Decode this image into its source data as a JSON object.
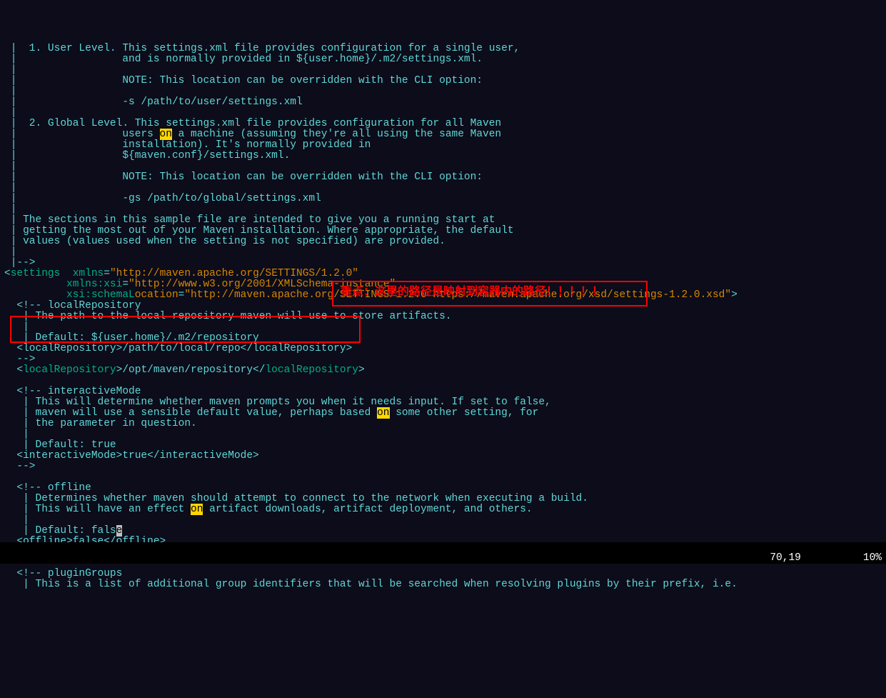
{
  "lines": [
    {
      "t": " |  1. User Level. This settings.xml file provides configuration for a single user,",
      "c": "cyan"
    },
    {
      "t": " |                 and is normally provided in ${user.home}/.m2/settings.xml.",
      "c": "cyan"
    },
    {
      "t": " |",
      "c": "cyan"
    },
    {
      "t": " |                 NOTE: This location can be overridden with the CLI option:",
      "c": "cyan"
    },
    {
      "t": " |",
      "c": "cyan"
    },
    {
      "t": " |                 -s /path/to/user/settings.xml",
      "c": "cyan"
    },
    {
      "t": " |",
      "c": "cyan"
    },
    {
      "t": " |  2. Global Level. This settings.xml file provides configuration for all Maven",
      "c": "cyan"
    },
    {
      "segs": [
        {
          "t": " |                 users ",
          "c": "cyan"
        },
        {
          "t": "on",
          "c": "hl"
        },
        {
          "t": " a machine (assuming they're all using the same Maven",
          "c": "cyan"
        }
      ]
    },
    {
      "t": " |                 installation). It's normally provided in",
      "c": "cyan"
    },
    {
      "t": " |                 ${maven.conf}/settings.xml.",
      "c": "cyan"
    },
    {
      "t": " |",
      "c": "cyan"
    },
    {
      "t": " |                 NOTE: This location can be overridden with the CLI option:",
      "c": "cyan"
    },
    {
      "t": " |",
      "c": "cyan"
    },
    {
      "t": " |                 -gs /path/to/global/settings.xml",
      "c": "cyan"
    },
    {
      "t": " |",
      "c": "cyan"
    },
    {
      "t": " | The sections in this sample file are intended to give you a running start at",
      "c": "cyan"
    },
    {
      "t": " | getting the most out of your Maven installation. Where appropriate, the default",
      "c": "cyan"
    },
    {
      "t": " | values (values used when the setting is not specified) are provided.",
      "c": "cyan"
    },
    {
      "t": " |",
      "c": "cyan"
    },
    {
      "t": " |-->",
      "c": "cyan"
    },
    {
      "segs": [
        {
          "t": "<",
          "c": "cyan"
        },
        {
          "t": "settings",
          "c": "green"
        },
        {
          "t": "  ",
          "c": "cyan"
        },
        {
          "t": "xmlns",
          "c": "green"
        },
        {
          "t": "=",
          "c": "cyan"
        },
        {
          "t": "\"http://maven.apache.org/SETTINGS/1.2.0\"",
          "c": "orange"
        }
      ]
    },
    {
      "segs": [
        {
          "t": "          ",
          "c": "cyan"
        },
        {
          "t": "xmlns:xsi",
          "c": "green"
        },
        {
          "t": "=",
          "c": "cyan"
        },
        {
          "t": "\"http://www.w3.org/2001/XMLSchema-instance\"",
          "c": "orange"
        }
      ]
    },
    {
      "segs": [
        {
          "t": "          ",
          "c": "cyan"
        },
        {
          "t": "xsi:schemaL",
          "c": "green"
        },
        {
          "t": "ocation",
          "c": "orange"
        },
        {
          "t": "=",
          "c": "cyan"
        },
        {
          "t": "\"http://maven.apache.org/SETTINGS/1.2.0 https://maven.apache.org/xsd/settings-1.2.0.xsd\"",
          "c": "orange"
        },
        {
          "t": ">",
          "c": "cyan"
        }
      ]
    },
    {
      "t": "  <!-- localRepository",
      "c": "cyan"
    },
    {
      "t": "   | The path to the local repository maven will use to store artifacts.",
      "c": "cyan"
    },
    {
      "t": "   |",
      "c": "cyan"
    },
    {
      "t": "   | Default: ${user.home}/.m2/repository",
      "c": "cyan"
    },
    {
      "t": "  <localRepository>/path/to/local/repo</localRepository>",
      "c": "cyan"
    },
    {
      "t": "  -->",
      "c": "cyan"
    },
    {
      "segs": [
        {
          "t": "  <",
          "c": "cyan"
        },
        {
          "t": "localRepository",
          "c": "green"
        },
        {
          "t": ">/opt/maven/repository</",
          "c": "cyan"
        },
        {
          "t": "localRepository",
          "c": "green"
        },
        {
          "t": ">",
          "c": "cyan"
        }
      ]
    },
    {
      "t": " ",
      "c": "cyan"
    },
    {
      "t": "  <!-- interactiveMode",
      "c": "cyan"
    },
    {
      "t": "   | This will determine whether maven prompts you when it needs input. If set to false,",
      "c": "cyan"
    },
    {
      "segs": [
        {
          "t": "   | maven will use a sensible default value, perhaps based ",
          "c": "cyan"
        },
        {
          "t": "on",
          "c": "hl"
        },
        {
          "t": " some other setting, for",
          "c": "cyan"
        }
      ]
    },
    {
      "t": "   | the parameter in question.",
      "c": "cyan"
    },
    {
      "t": "   |",
      "c": "cyan"
    },
    {
      "t": "   | Default: true",
      "c": "cyan"
    },
    {
      "t": "  <interactiveMode>true</interactiveMode>",
      "c": "cyan"
    },
    {
      "t": "  -->",
      "c": "cyan"
    },
    {
      "t": " ",
      "c": "cyan"
    },
    {
      "t": "  <!-- offline",
      "c": "cyan"
    },
    {
      "t": "   | Determines whether maven should attempt to connect to the network when executing a build.",
      "c": "cyan"
    },
    {
      "segs": [
        {
          "t": "   | This will have an effect ",
          "c": "cyan"
        },
        {
          "t": "on",
          "c": "hl"
        },
        {
          "t": " artifact downloads, artifact deployment, and others.",
          "c": "cyan"
        }
      ]
    },
    {
      "t": "   |",
      "c": "cyan"
    },
    {
      "segs": [
        {
          "t": "   | Default: fals",
          "c": "cyan"
        },
        {
          "t": "e",
          "c": "cursor"
        }
      ]
    },
    {
      "t": "  <offline>false</offline>",
      "c": "cyan"
    },
    {
      "t": "  -->",
      "c": "cyan"
    },
    {
      "t": " ",
      "c": "cyan"
    },
    {
      "t": "  <!-- pluginGroups",
      "c": "cyan"
    },
    {
      "t": "   | This is a list of additional group identifiers that will be searched when resolving plugins by their prefix, i.e.",
      "c": "cyan"
    }
  ],
  "status": {
    "pos": "70,19",
    "pct": "10%"
  },
  "annotation": "重点：这里的路径是映射到容器内的路径！！！！！"
}
